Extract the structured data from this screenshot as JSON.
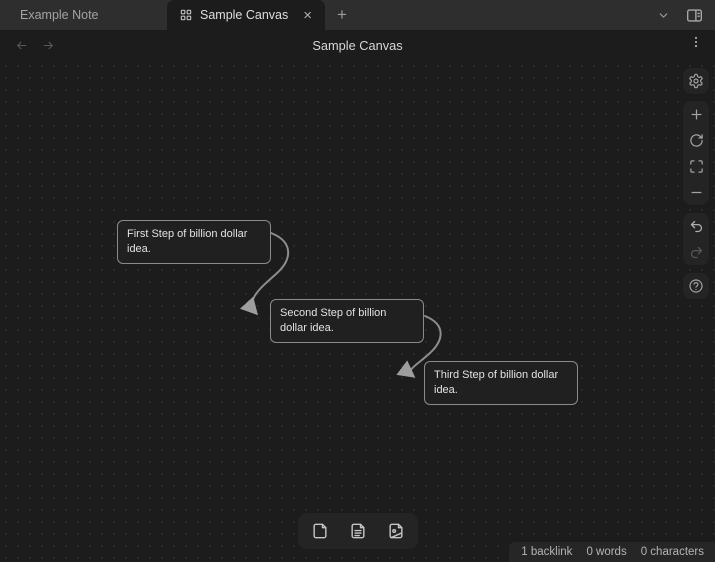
{
  "tab_bar": {
    "tabs": [
      {
        "label": "Example Note"
      },
      {
        "label": "Sample Canvas"
      }
    ],
    "icons": {
      "close": "×",
      "new_tab": "+"
    }
  },
  "header": {
    "title": "Sample Canvas"
  },
  "canvas": {
    "nodes": [
      {
        "text": "First Step of billion dollar idea.",
        "lines": [
          "First Step of billion dollar",
          "idea."
        ]
      },
      {
        "text": "Second Step of billion dollar idea.",
        "lines": [
          "Second Step of billion",
          "dollar idea."
        ]
      },
      {
        "text": "Third Step of billion dollar idea.",
        "lines": [
          "Third Step of billion dollar",
          "idea."
        ]
      }
    ]
  },
  "status_bar": {
    "items": [
      "1 backlink",
      "0 words",
      "0 characters"
    ]
  },
  "colors": {
    "background": "#1c1c1c",
    "tab_bar": "#2e2e2e",
    "panel": "#242424",
    "node_border": "#8a8a8a",
    "edge": "#8d8d8d",
    "text_bright": "#dedede",
    "text_muted": "#a3a3a3"
  }
}
